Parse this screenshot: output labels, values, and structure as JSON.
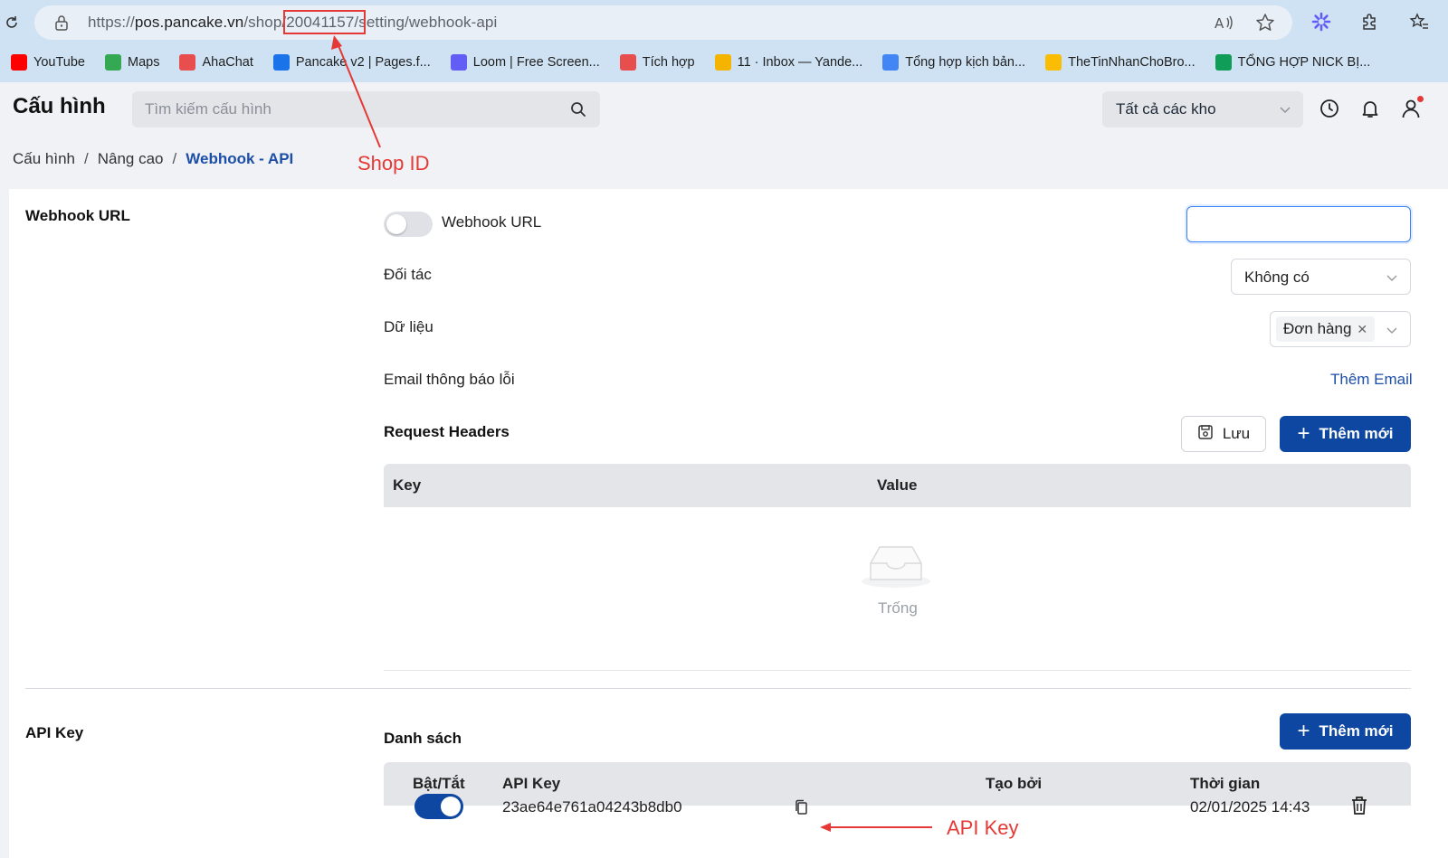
{
  "browser": {
    "url_prefix": "https://",
    "url_host": "pos.pancake.vn",
    "url_path_a": "/shop/",
    "url_shop_id": "20041157",
    "url_path_b": "/setting/webhook-api",
    "bookmarks": [
      {
        "label": "YouTube",
        "icon": "youtube-icon",
        "color": "#ff0000"
      },
      {
        "label": "Maps",
        "icon": "maps-icon",
        "color": "#34a853"
      },
      {
        "label": "AhaChat",
        "icon": "ahachat-icon",
        "color": "#e84e4e"
      },
      {
        "label": "Pancake v2 | Pages.f...",
        "icon": "pancake-icon",
        "color": "#1a73e8"
      },
      {
        "label": "Loom | Free Screen...",
        "icon": "loom-icon",
        "color": "#625df5"
      },
      {
        "label": "Tích hợp",
        "icon": "integration-icon",
        "color": "#e84e4e"
      },
      {
        "label": "11 · Inbox — Yande...",
        "icon": "mail-icon",
        "color": "#f5b400"
      },
      {
        "label": "Tổng hợp kịch bản...",
        "icon": "docs-icon",
        "color": "#4285f4"
      },
      {
        "label": "TheTinNhanChoBro...",
        "icon": "drive-icon",
        "color": "#fbbc04"
      },
      {
        "label": "TỔNG HỢP NICK BỊ...",
        "icon": "sheets-icon",
        "color": "#0f9d58"
      }
    ]
  },
  "header": {
    "title": "Cấu hình",
    "search_placeholder": "Tìm kiếm cấu hình",
    "store_select": "Tất cả các kho"
  },
  "breadcrumb": {
    "items": [
      "Cấu hình",
      "Nâng cao"
    ],
    "active": "Webhook - API",
    "sep": "/"
  },
  "webhook": {
    "section_label": "Webhook URL",
    "toggle_label": "Webhook URL",
    "partner_label": "Đối tác",
    "partner_value": "Không có",
    "data_label": "Dữ liệu",
    "data_tag": "Đơn hàng",
    "email_label": "Email thông báo lỗi",
    "add_email": "Thêm Email",
    "headers_label": "Request Headers",
    "save_label": "Lưu",
    "add_new_label": "Thêm mới",
    "col_key": "Key",
    "col_value": "Value",
    "empty_text": "Trống"
  },
  "api_key": {
    "section_label": "API Key",
    "list_label": "Danh sách",
    "add_new_label": "Thêm mới",
    "columns": [
      "Bật/Tắt",
      "API Key",
      "Tạo bởi",
      "Thời gian"
    ],
    "rows": [
      {
        "enabled": true,
        "key": "23ae64e761a04243b8db0",
        "created_by": "",
        "time": "02/01/2025 14:43"
      }
    ]
  },
  "annotations": {
    "shop_id": "Shop ID",
    "api_key": "API Key",
    "color": "#e53935"
  },
  "colors": {
    "primary": "#0d47a1",
    "link": "#1d4fa8",
    "chrome": "#cfe2f3"
  }
}
